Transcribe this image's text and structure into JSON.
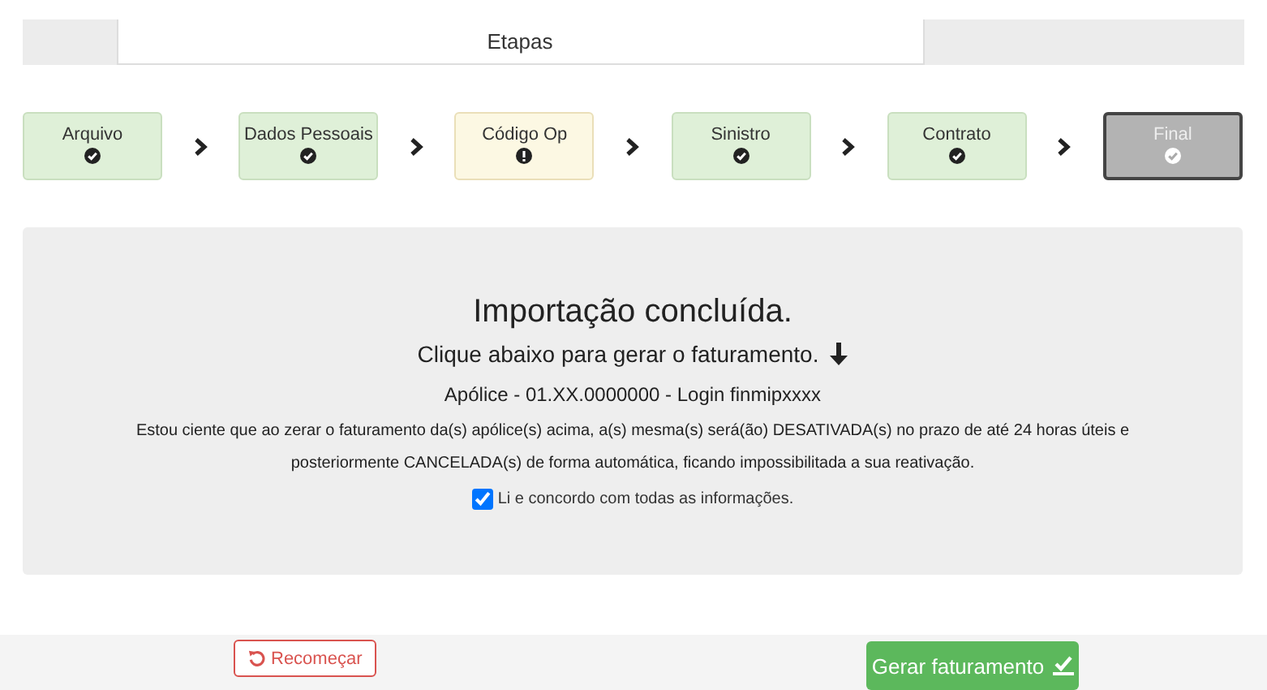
{
  "header": {
    "title": "Etapas"
  },
  "steps": [
    {
      "label": "Arquivo",
      "kind": "done"
    },
    {
      "label": "Dados Pessoais",
      "kind": "done"
    },
    {
      "label": "Código Op",
      "kind": "warning"
    },
    {
      "label": "Sinistro",
      "kind": "done"
    },
    {
      "label": "Contrato",
      "kind": "done"
    },
    {
      "label": "Final",
      "kind": "active"
    }
  ],
  "panel": {
    "title": "Importação concluída.",
    "subtitle": "Clique abaixo para gerar o faturamento.",
    "policy": "Apólice - 01.XX.0000000 - Login finmipxxxx",
    "notice": "Estou ciente que ao zerar o faturamento da(s) apólice(s) acima, a(s) mesma(s) será(ão) DESATIVADA(s) no prazo de até 24 horas úteis e posteriormente CANCELADA(s) de forma automática, ficando impossibilitada a sua reativação.",
    "agree": {
      "label": "Li e concordo com todas as informações.",
      "checked": true
    }
  },
  "footer": {
    "restart": "Recomeçar",
    "generate": "Gerar faturamento"
  }
}
